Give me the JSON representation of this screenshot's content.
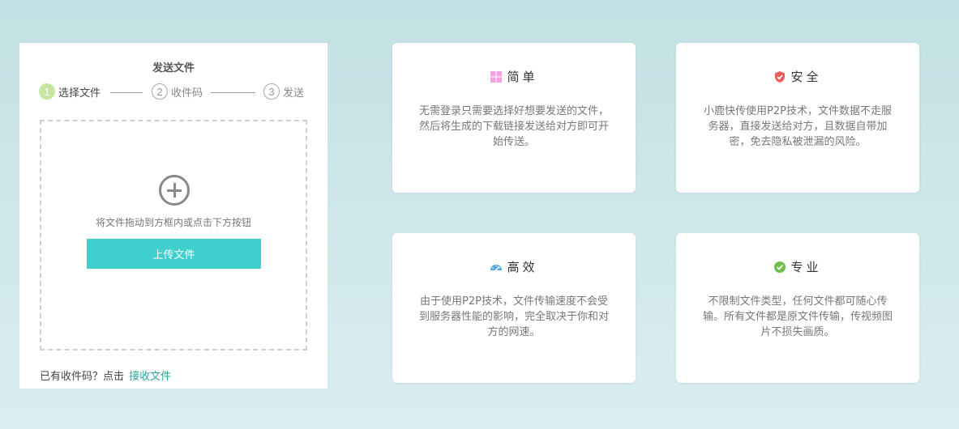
{
  "upload": {
    "title": "发送文件",
    "steps": [
      {
        "num": "1",
        "label": "选择文件"
      },
      {
        "num": "2",
        "label": "收件码"
      },
      {
        "num": "3",
        "label": "发送"
      }
    ],
    "drop_hint": "将文件拖动到方框内或点击下方按钮",
    "upload_button": "上传文件",
    "receive_prefix": "已有收件码？点击",
    "receive_link": "接收文件"
  },
  "colors": {
    "accent": "#3fd0ce",
    "link": "#2aa398",
    "step_active": "#c5e5a0"
  },
  "features": [
    {
      "icon": "windows-grid-icon",
      "title": "简单",
      "desc": "无需登录只需要选择好想要发送的文件，然后将生成的下载链接发送给对方即可开始传送。",
      "icon_color": "#f5a3e0"
    },
    {
      "icon": "shield-icon",
      "title": "安全",
      "desc": "小鹿快传使用P2P技术，文件数据不走服务器，直接发送给对方，且数据自带加密，免去隐私被泄漏的风险。",
      "icon_color": "#ef5b5b"
    },
    {
      "icon": "speedometer-icon",
      "title": "高效",
      "desc": "由于使用P2P技术，文件传输速度不会受到服务器性能的影响，完全取决于你和对方的网速。",
      "icon_color": "#4aa3df"
    },
    {
      "icon": "check-circle-icon",
      "title": "专业",
      "desc": "不限制文件类型，任何文件都可随心传输。所有文件都是原文件传输，传视频图片不损失画质。",
      "icon_color": "#6cc04a"
    }
  ]
}
